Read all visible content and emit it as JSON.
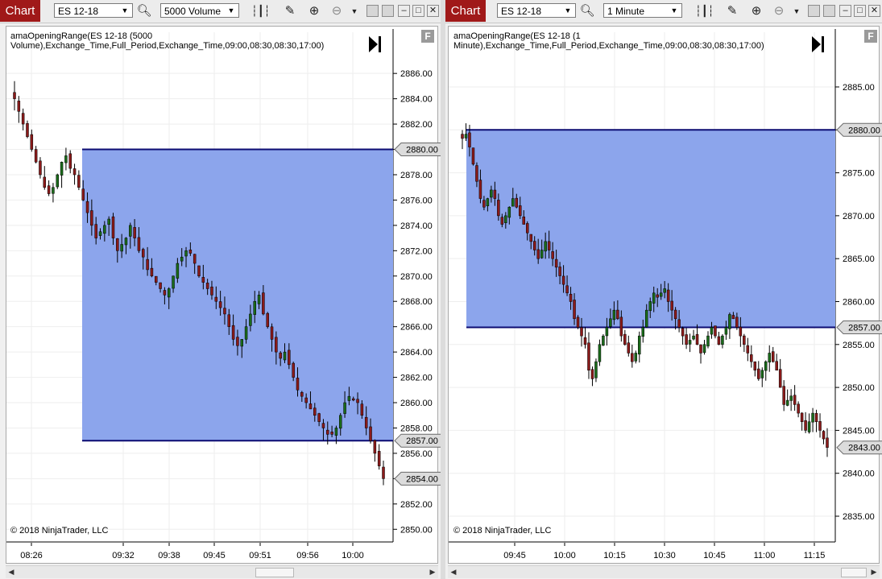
{
  "left": {
    "tab_label": "Chart",
    "instrument": "ES 12-18",
    "interval": "5000 Volume",
    "indicator_label": "amaOpeningRange(ES 12-18 (5000 Volume),Exchange_Time,Full_Period,Exchange_Time,09:00,08:30,08:30,17:00)",
    "copyright": "© 2018 NinjaTrader, LLC",
    "f_button": "F",
    "range_high_label": "2880.00",
    "range_low_label": "2857.00",
    "last_price_label": "2854.00",
    "y_ticks": [
      "2886.00",
      "2884.00",
      "2882.00",
      "2880.00",
      "2878.00",
      "2876.00",
      "2874.00",
      "2872.00",
      "2870.00",
      "2868.00",
      "2866.00",
      "2864.00",
      "2862.00",
      "2860.00",
      "2858.00",
      "2856.00",
      "2854.00",
      "2852.00",
      "2850.00"
    ],
    "x_ticks": [
      "08:26",
      "09:32",
      "09:38",
      "09:45",
      "09:51",
      "09:56",
      "10:00"
    ],
    "colors": {
      "range_fill": "#8ca5ec",
      "range_line": "#0c0c72",
      "up_bar": "#1a6b1a",
      "down_bar": "#8b1a1a"
    }
  },
  "right": {
    "tab_label": "Chart",
    "instrument": "ES 12-18",
    "interval": "1 Minute",
    "indicator_label": "amaOpeningRange(ES 12-18 (1 Minute),Exchange_Time,Full_Period,Exchange_Time,09:00,08:30,08:30,17:00)",
    "copyright": "© 2018 NinjaTrader, LLC",
    "f_button": "F",
    "range_high_label": "2880.00",
    "range_low_label": "2857.00",
    "last_price_label": "2843.00",
    "y_ticks": [
      "2885.00",
      "2880.00",
      "2875.00",
      "2870.00",
      "2865.00",
      "2860.00",
      "2855.00",
      "2850.00",
      "2845.00",
      "2840.00",
      "2835.00"
    ],
    "x_ticks": [
      "09:45",
      "10:00",
      "10:15",
      "10:30",
      "10:45",
      "11:00",
      "11:15"
    ],
    "colors": {
      "range_fill": "#8ca5ec",
      "range_line": "#0c0c72",
      "up_bar": "#1a6b1a",
      "down_bar": "#8b1a1a"
    }
  },
  "chart_data": [
    {
      "type": "candlestick",
      "title": "amaOpeningRange(ES 12-18 (5000 Volume),Exchange_Time,Full_Period,Exchange_Time,09:00,08:30,08:30,17:00)",
      "ylim": [
        2849,
        2889
      ],
      "x_ticks": [
        "08:26",
        "09:32",
        "09:38",
        "09:45",
        "09:51",
        "09:56",
        "10:00"
      ],
      "opening_range": {
        "high": 2880.0,
        "low": 2857.0
      },
      "close_path": [
        2884,
        2883,
        2882,
        2881,
        2880,
        2879,
        2878,
        2877,
        2876.5,
        2877,
        2878,
        2879,
        2879.5,
        2878.5,
        2878,
        2877,
        2876,
        2875,
        2874,
        2873,
        2873.5,
        2874,
        2874.5,
        2873,
        2872,
        2872.5,
        2873,
        2874,
        2873,
        2872,
        2871.5,
        2870.5,
        2870,
        2869.5,
        2869,
        2868.5,
        2869,
        2870,
        2871,
        2871.5,
        2872,
        2871.8,
        2871,
        2870,
        2869.5,
        2869,
        2868.5,
        2868,
        2867.5,
        2867,
        2866,
        2865,
        2864.5,
        2865,
        2866,
        2867,
        2868,
        2868.5,
        2867,
        2866,
        2865,
        2864,
        2863.5,
        2864,
        2863,
        2862,
        2861,
        2860.5,
        2860,
        2859.5,
        2859,
        2858.5,
        2858,
        2857.5,
        2857.5,
        2858,
        2859,
        2860,
        2860.5,
        2860.2,
        2860,
        2859,
        2858,
        2857,
        2856,
        2855,
        2854
      ],
      "last_price": 2854.0
    },
    {
      "type": "candlestick",
      "title": "amaOpeningRange(ES 12-18 (1 Minute),Exchange_Time,Full_Period,Exchange_Time,09:00,08:30,08:30,17:00)",
      "ylim": [
        2832,
        2891
      ],
      "x_ticks": [
        "09:45",
        "10:00",
        "10:15",
        "10:30",
        "10:45",
        "11:00",
        "11:15"
      ],
      "opening_range": {
        "high": 2880.0,
        "low": 2857.0
      },
      "close_path": [
        2879,
        2879.5,
        2878,
        2876,
        2874,
        2872,
        2871,
        2872,
        2873,
        2872,
        2870,
        2869,
        2870,
        2871,
        2872,
        2871,
        2870,
        2869,
        2868,
        2867,
        2866,
        2865,
        2866,
        2867,
        2866,
        2865,
        2864,
        2863,
        2862,
        2861,
        2860,
        2858,
        2857,
        2856,
        2855,
        2852,
        2851,
        2853,
        2855,
        2856,
        2857,
        2858,
        2859,
        2858,
        2856,
        2855,
        2854,
        2853,
        2854,
        2856,
        2857,
        2859,
        2860,
        2861,
        2860.5,
        2861,
        2861.5,
        2860,
        2859,
        2858,
        2857,
        2856,
        2855,
        2855.5,
        2856,
        2855,
        2854,
        2855,
        2856,
        2857,
        2856,
        2855,
        2856,
        2857,
        2858.5,
        2858,
        2857,
        2856,
        2855,
        2854,
        2853,
        2852,
        2851,
        2852,
        2853,
        2854,
        2853,
        2852,
        2850,
        2848,
        2848.5,
        2849,
        2848,
        2847,
        2846,
        2845,
        2846,
        2847,
        2846,
        2845,
        2844,
        2843
      ]
    }
  ]
}
